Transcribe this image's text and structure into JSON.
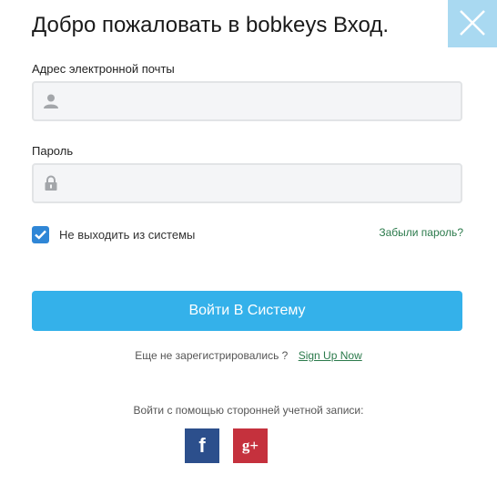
{
  "dialog": {
    "title": "Добро пожаловать в bobkeys Вход.",
    "close_icon": "close-icon"
  },
  "email": {
    "label": "Адрес электронной почты",
    "value": "",
    "placeholder": "",
    "icon": "user-icon"
  },
  "password": {
    "label": "Пароль",
    "value": "",
    "placeholder": "",
    "icon": "lock-icon"
  },
  "remember": {
    "label": "Не выходить из системы",
    "checked": true
  },
  "forgot_link": "Забыли пароль?",
  "login_button": "Войти В Систему",
  "signup": {
    "prompt": "Еще не зарегистрировались ?",
    "link": "Sign Up Now"
  },
  "social": {
    "label": "Войти с помощью сторонней учетной записи:",
    "facebook_glyph": "f",
    "google_glyph": "g+"
  },
  "colors": {
    "accent": "#34b1ea",
    "close_bg": "#a9d9f1",
    "link": "#2b7a4b",
    "checkbox": "#2f86d6",
    "facebook": "#2c4f8c",
    "google": "#c5313d"
  }
}
